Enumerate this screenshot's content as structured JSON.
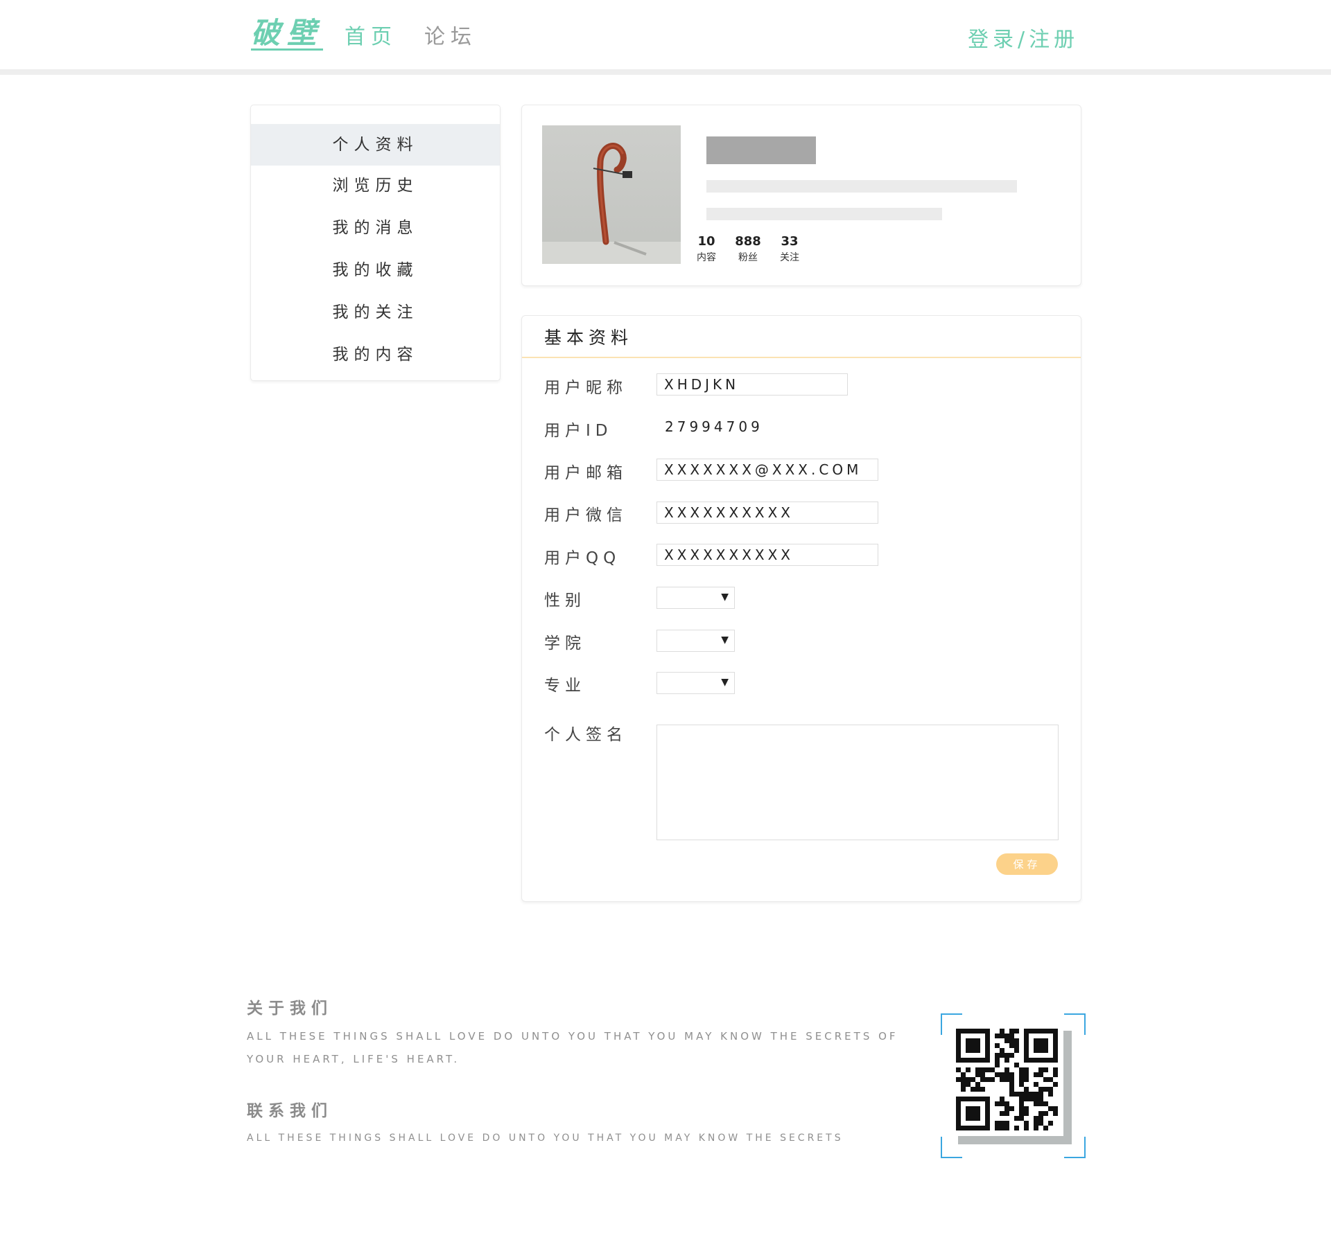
{
  "header": {
    "logo": "破壁",
    "nav": {
      "home": "首页",
      "forum": "论坛"
    },
    "login": "登录/注册"
  },
  "sidebar": {
    "items": [
      {
        "label": "个人资料",
        "active": true
      },
      {
        "label": "浏览历史",
        "active": false
      },
      {
        "label": "我的消息",
        "active": false
      },
      {
        "label": "我的收藏",
        "active": false
      },
      {
        "label": "我的关注",
        "active": false
      },
      {
        "label": "我的内容",
        "active": false
      }
    ]
  },
  "profile": {
    "stats": [
      {
        "value": "10",
        "label": "内容"
      },
      {
        "value": "888",
        "label": "粉丝"
      },
      {
        "value": "33",
        "label": "关注"
      }
    ]
  },
  "basic_info": {
    "title": "基本资料",
    "fields": {
      "nickname": {
        "label": "用户昵称",
        "value": "XHDJKN"
      },
      "user_id": {
        "label": "用户ID",
        "value": "27994709"
      },
      "email": {
        "label": "用户邮箱",
        "value": "XXXXXXX@XXX.COM"
      },
      "wechat": {
        "label": "用户微信",
        "value": "XXXXXXXXXX"
      },
      "qq": {
        "label": "用户QQ",
        "value": "XXXXXXXXXX"
      },
      "gender": {
        "label": "性别",
        "value": ""
      },
      "college": {
        "label": "学院",
        "value": ""
      },
      "major": {
        "label": "专业",
        "value": ""
      },
      "signature": {
        "label": "个人签名",
        "value": ""
      }
    },
    "save_label": "保存"
  },
  "footer": {
    "about": {
      "title": "关于我们",
      "text": "ALL THESE THINGS SHALL LOVE DO UNTO YOU THAT YOU MAY KNOW THE SECRETS OF YOUR HEART, LIFE'S HEART."
    },
    "contact": {
      "title": "联系我们",
      "text": "ALL THESE THINGS SHALL LOVE DO UNTO YOU THAT YOU MAY KNOW THE SECRETS"
    }
  },
  "colors": {
    "brand": "#6dcfb1",
    "accent": "#fcd28a",
    "qr_frame": "#3aa6e0"
  }
}
